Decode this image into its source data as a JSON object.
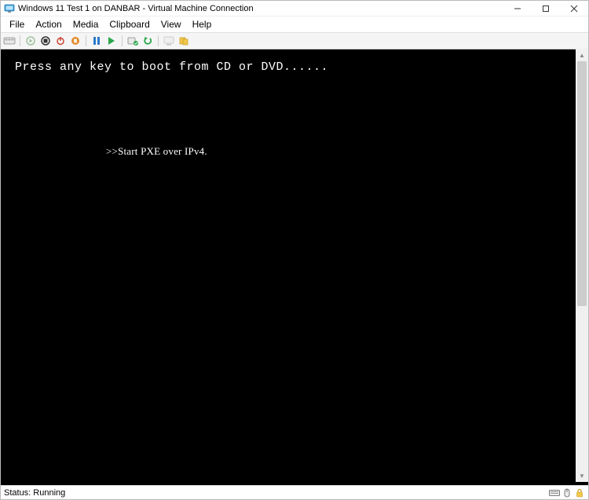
{
  "title": "Windows 11 Test 1 on DANBAR - Virtual Machine Connection",
  "menu": {
    "file": "File",
    "action": "Action",
    "media": "Media",
    "clipboard": "Clipboard",
    "view": "View",
    "help": "Help"
  },
  "toolbar_icons": {
    "ctrl_alt_del": "ctrl-alt-del-icon",
    "start": "start-icon",
    "turnoff": "turn-off-icon",
    "shutdown": "shutdown-icon",
    "save": "save-icon",
    "pause": "pause-icon",
    "reset": "reset-icon",
    "checkpoint": "checkpoint-icon",
    "revert": "revert-icon",
    "enhanced": "enhanced-session-icon",
    "share": "share-icon"
  },
  "console": {
    "boot_prompt": "Press any key to boot from CD or DVD......",
    "pxe_line": ">>Start PXE over IPv4."
  },
  "status": {
    "text": "Status: Running"
  }
}
